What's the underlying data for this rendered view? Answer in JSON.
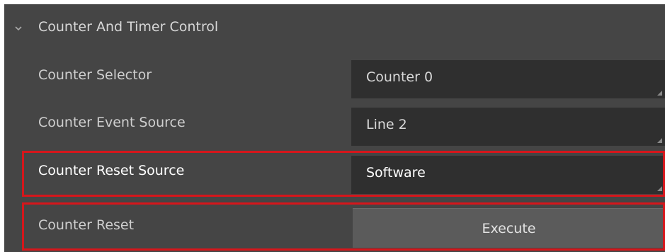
{
  "section": {
    "title": "Counter And Timer Control",
    "expanded_icon": "chevron-down-icon"
  },
  "rows": [
    {
      "label": "Counter Selector",
      "value": "Counter 0"
    },
    {
      "label": "Counter Event Source",
      "value": "Line 2"
    },
    {
      "label": "Counter Reset Source",
      "value": "Software"
    },
    {
      "label": "Counter Reset",
      "button_label": "Execute"
    }
  ],
  "colors": {
    "panel_background": "#454545",
    "field_background": "#2f2f2f",
    "button_background": "#5b5b5b",
    "highlight_border": "#d6161b"
  }
}
